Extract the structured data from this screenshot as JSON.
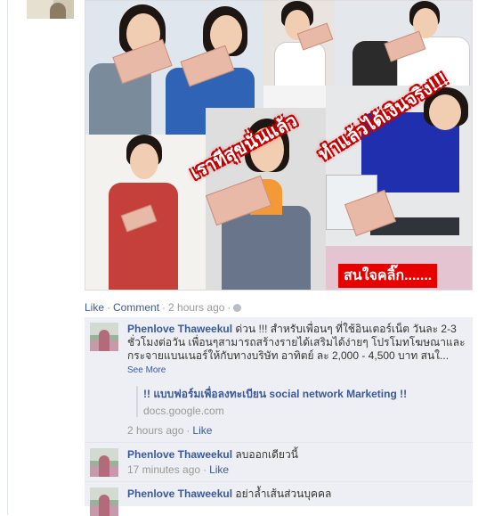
{
  "post": {
    "overlay_text_1": "เราทีสุขนั่นแล้ว",
    "overlay_text_2": "ทำแล้วได้เงินจริง!!!",
    "overlay_text_3": "สนใจคลิ๊ก.......",
    "actions": {
      "like": "Like",
      "comment": "Comment",
      "time": "2 hours ago"
    }
  },
  "comments": [
    {
      "author": "Phenlove Thaweekul",
      "text": "ด่วน !!! สำหรับเพื่อนๆ ที่ใช้อินเตอร์เน็ต วันละ 2-3 ชั่วโมงต่อวัน เพื่อนๆสามารถสร้างรายได้เสริมได้ง่ายๆ โปรโมทโฆษณาและกระจายแบนเนอร์ให้กับทางบริษัท อาทิตย์ ละ 2,000 - 4,500 บาท สนใ...",
      "see_more": "See More",
      "share_title": "!! แบบฟอร์มเพื่อลงทะเบียน social network Marketing !!",
      "share_url": "docs.google.com",
      "time": "2 hours ago",
      "like": "Like"
    },
    {
      "author": "Phenlove Thaweekul",
      "text": "ลบออกเดียวนี้",
      "time": "17 minutes ago",
      "like": "Like"
    },
    {
      "author": "Phenlove Thaweekul",
      "text": "อย่าล้ำเส้นส่วนบุคคล"
    }
  ],
  "colors": {
    "link": "#3b5998",
    "comment_bg": "#edeff4",
    "overlay_red": "#e60000"
  }
}
